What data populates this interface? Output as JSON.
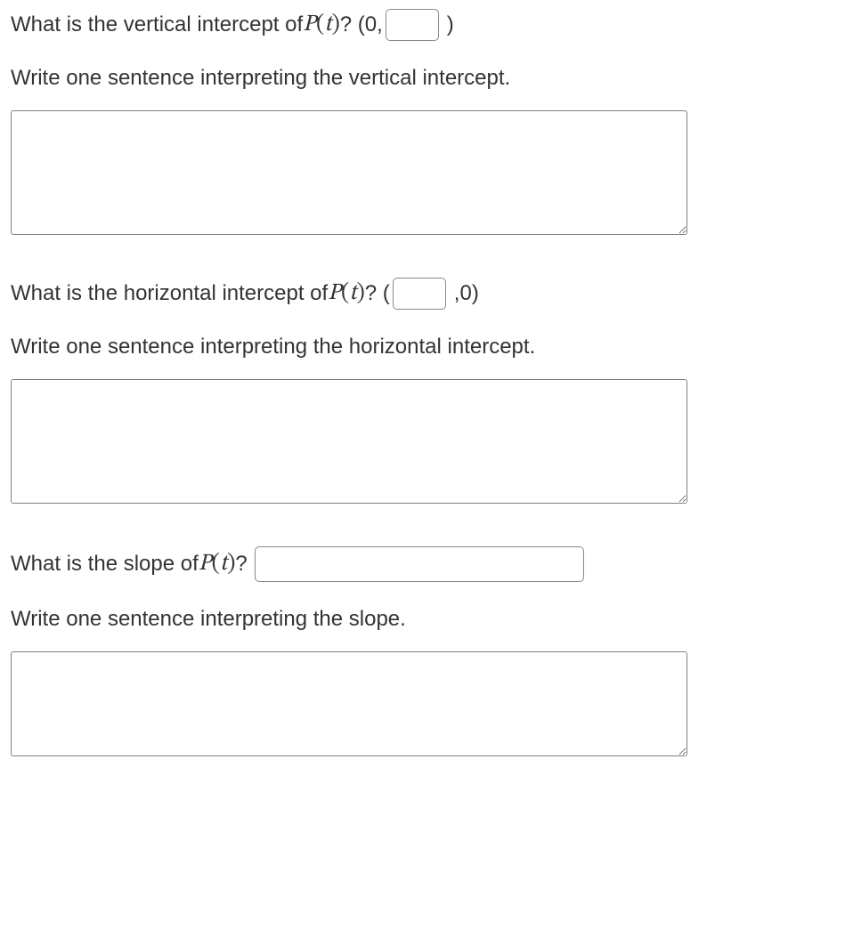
{
  "q1": {
    "prefix": "What is the vertical intercept of ",
    "fn": "P",
    "arg": "t",
    "after": "? (0,",
    "close": ")",
    "interpret": "Write one sentence interpreting the vertical intercept."
  },
  "q2": {
    "prefix": "What is the horizontal intercept of ",
    "fn": "P",
    "arg": "t",
    "after": "? (",
    "close": ",0)",
    "interpret": "Write one sentence interpreting the horizontal intercept."
  },
  "q3": {
    "prefix": "What is the slope of ",
    "fn": "P",
    "arg": "t",
    "after": "?",
    "interpret": "Write one sentence interpreting the slope."
  }
}
